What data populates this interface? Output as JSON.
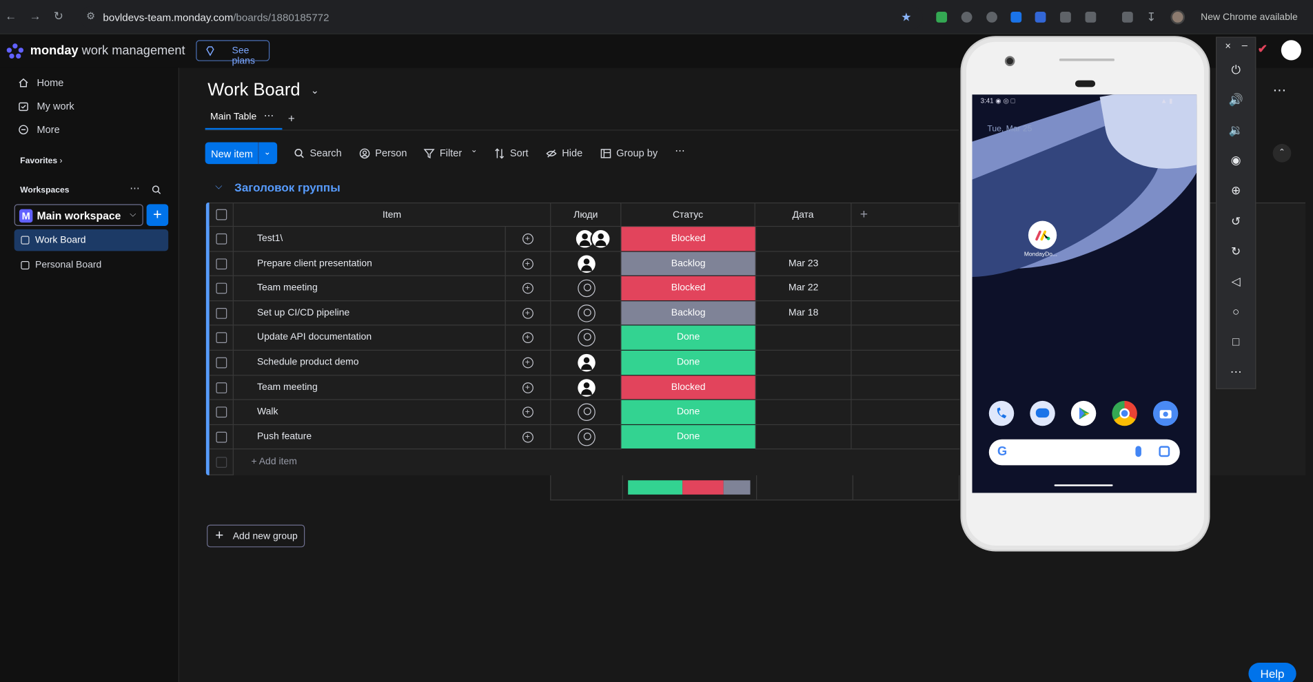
{
  "browser": {
    "url_host": "bovldevs-team.monday.com",
    "url_path": "/boards/1880185772",
    "new_chrome": "New Chrome available"
  },
  "header": {
    "brand_bold": "monday",
    "brand_light": "work management",
    "see_plans": "See plans"
  },
  "sidebar": {
    "home": "Home",
    "my_work": "My work",
    "more": "More",
    "favorites": "Favorites",
    "workspaces": "Workspaces",
    "workspace_badge": "M",
    "workspace_name": "Main workspace",
    "boards": [
      "Work Board",
      "Personal Board"
    ]
  },
  "board": {
    "title": "Work Board",
    "tab": "Main Table",
    "toolbar": {
      "new_item": "New item",
      "search": "Search",
      "person": "Person",
      "filter": "Filter",
      "sort": "Sort",
      "hide": "Hide",
      "group_by": "Group by"
    },
    "group_title": "Заголовок группы",
    "columns": {
      "item": "Item",
      "people": "Люди",
      "status": "Статус",
      "date": "Дата"
    },
    "rows": [
      {
        "name": "Test1\\",
        "people": "two",
        "status": "Blocked",
        "date": ""
      },
      {
        "name": "Prepare client presentation",
        "people": "full",
        "status": "Backlog",
        "date": "Mar 23"
      },
      {
        "name": "Team meeting",
        "people": "empty",
        "status": "Blocked",
        "date": "Mar 22"
      },
      {
        "name": "Set up CI/CD pipeline",
        "people": "empty",
        "status": "Backlog",
        "date": "Mar 18"
      },
      {
        "name": "Update API documentation",
        "people": "empty",
        "status": "Done",
        "date": ""
      },
      {
        "name": "Schedule product demo",
        "people": "full",
        "status": "Done",
        "date": ""
      },
      {
        "name": "Team meeting",
        "people": "full",
        "status": "Blocked",
        "date": ""
      },
      {
        "name": "Walk",
        "people": "empty",
        "status": "Done",
        "date": ""
      },
      {
        "name": "Push feature",
        "people": "empty",
        "status": "Done",
        "date": ""
      }
    ],
    "add_item": "+ Add item",
    "status_summary": [
      {
        "status": "Done",
        "fraction": 0.444,
        "color": "#33d391"
      },
      {
        "status": "Blocked",
        "fraction": 0.333,
        "color": "#e2445c"
      },
      {
        "status": "Backlog",
        "fraction": 0.222,
        "color": "#7f8397"
      }
    ],
    "add_group": "Add new group"
  },
  "status_colors": {
    "Blocked": "#e2445c",
    "Backlog": "#7f8397",
    "Done": "#33d391"
  },
  "phone": {
    "time": "3:41",
    "date": "Tue, Mar 25",
    "app_label": "MondayDo..."
  },
  "help": "Help"
}
